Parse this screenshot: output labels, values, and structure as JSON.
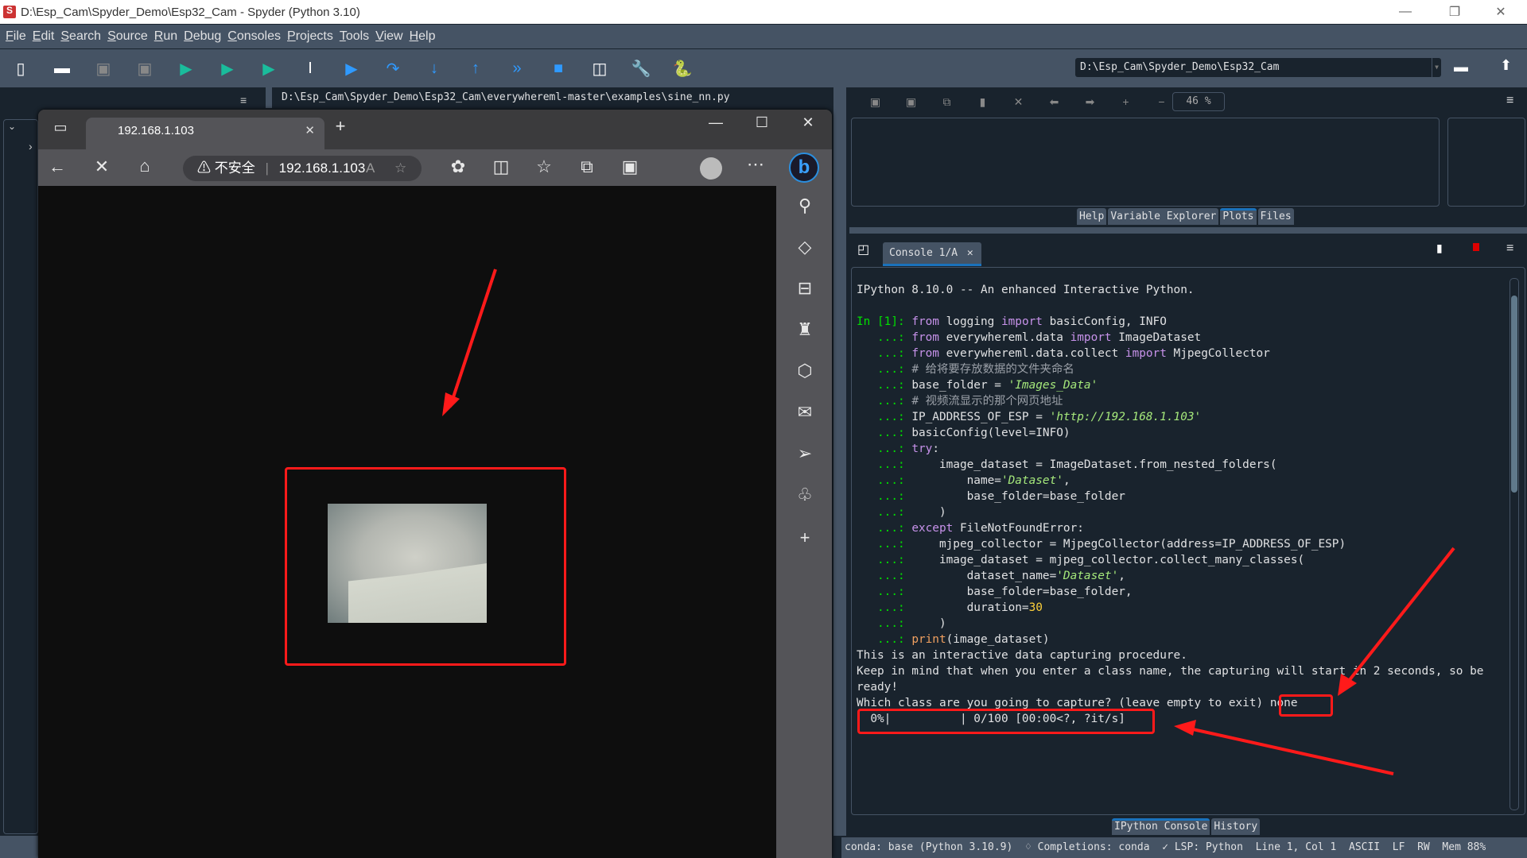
{
  "window": {
    "title": "D:\\Esp_Cam\\Spyder_Demo\\Esp32_Cam - Spyder (Python 3.10)",
    "min": "—",
    "restore": "❐",
    "close": "✕"
  },
  "menu": [
    "File",
    "Edit",
    "Search",
    "Source",
    "Run",
    "Debug",
    "Consoles",
    "Projects",
    "Tools",
    "View",
    "Help"
  ],
  "toolbar": {
    "icons": [
      {
        "name": "new-file-icon",
        "glyph": "▯",
        "color": "#ffffff"
      },
      {
        "name": "open-file-icon",
        "glyph": "▬",
        "color": "#ffffff"
      },
      {
        "name": "save-icon",
        "glyph": "▣",
        "color": "#888888"
      },
      {
        "name": "save-all-icon",
        "glyph": "▣",
        "color": "#888888"
      },
      {
        "name": "run-icon",
        "glyph": "▶",
        "color": "#1abc9c"
      },
      {
        "name": "run-cell-icon",
        "glyph": "▶",
        "color": "#1abc9c"
      },
      {
        "name": "run-cell-advance-icon",
        "glyph": "▶",
        "color": "#1abc9c"
      },
      {
        "name": "run-selection-icon",
        "glyph": "I",
        "color": "#ffffff"
      },
      {
        "name": "debug-icon",
        "glyph": "▶",
        "color": "#2f9aff"
      },
      {
        "name": "step-over-icon",
        "glyph": "↷",
        "color": "#2f9aff"
      },
      {
        "name": "step-into-icon",
        "glyph": "↓",
        "color": "#2f9aff"
      },
      {
        "name": "step-return-icon",
        "glyph": "↑",
        "color": "#2f9aff"
      },
      {
        "name": "continue-icon",
        "glyph": "»",
        "color": "#2f9aff"
      },
      {
        "name": "stop-debug-icon",
        "glyph": "■",
        "color": "#2f9aff"
      },
      {
        "name": "maximize-pane-icon",
        "glyph": "◫",
        "color": "#ffffff"
      },
      {
        "name": "preferences-wrench-icon",
        "glyph": "🔧",
        "color": "#ffffff"
      },
      {
        "name": "python-path-icon",
        "glyph": "🐍",
        "color": "#f5c542"
      }
    ],
    "cwd": "D:\\Esp_Cam\\Spyder_Demo\\Esp32_Cam"
  },
  "editor": {
    "path": "D:\\Esp_Cam\\Spyder_Demo\\Esp32_Cam\\everywhereml-master\\examples\\sine_nn.py"
  },
  "browser": {
    "tab_title": "192.168.1.103",
    "security_label": "不安全",
    "url": "192.168.1.103",
    "sidebar_icons": [
      "search-icon",
      "tag-icon",
      "toolbox-icon",
      "games-chess-icon",
      "office-icon",
      "outlook-icon",
      "send-icon",
      "tree-icon",
      "add-icon"
    ]
  },
  "plots": {
    "zoom": "46 %",
    "tabs": [
      "Help",
      "Variable Explorer",
      "Plots",
      "Files"
    ],
    "active_tab": "Plots"
  },
  "console": {
    "tab_label": "Console 1/A",
    "header": "IPython 8.10.0 -- An enhanced Interactive Python.",
    "prompt_in": "In [1]:",
    "cont": "   ...:",
    "code": [
      [
        [
          "kw",
          "from"
        ],
        [
          "t",
          " logging "
        ],
        [
          "kw",
          "import"
        ],
        [
          "t",
          " basicConfig, INFO"
        ]
      ],
      [
        [
          "kw",
          "from"
        ],
        [
          "t",
          " everywhereml.data "
        ],
        [
          "kw",
          "import"
        ],
        [
          "t",
          " ImageDataset"
        ]
      ],
      [
        [
          "kw",
          "from"
        ],
        [
          "t",
          " everywhereml.data.collect "
        ],
        [
          "kw",
          "import"
        ],
        [
          "t",
          " MjpegCollector"
        ]
      ],
      [
        [
          "cm",
          "# 给将要存放数据的文件夹命名"
        ]
      ],
      [
        [
          "t",
          "base_folder = "
        ],
        [
          "st",
          "'Images_Data'"
        ]
      ],
      [
        [
          "cm",
          "# 视频流显示的那个网页地址"
        ]
      ],
      [
        [
          "t",
          "IP_ADDRESS_OF_ESP = "
        ],
        [
          "st",
          "'http://192.168.1.103'"
        ]
      ],
      [
        [
          "t",
          "basicConfig(level=INFO)"
        ]
      ],
      [
        [
          "kw",
          "try"
        ],
        [
          "t",
          ":"
        ]
      ],
      [
        [
          "t",
          "    image_dataset = ImageDataset.from_nested_folders("
        ]
      ],
      [
        [
          "t",
          "        name="
        ],
        [
          "st",
          "'Dataset'"
        ],
        [
          "t",
          ","
        ]
      ],
      [
        [
          "t",
          "        base_folder=base_folder"
        ]
      ],
      [
        [
          "t",
          "    )"
        ]
      ],
      [
        [
          "kw",
          "except"
        ],
        [
          "t",
          " FileNotFoundError:"
        ]
      ],
      [
        [
          "t",
          "    mjpeg_collector = MjpegCollector(address=IP_ADDRESS_OF_ESP)"
        ]
      ],
      [
        [
          "t",
          "    image_dataset = mjpeg_collector.collect_many_classes("
        ]
      ],
      [
        [
          "t",
          "        dataset_name="
        ],
        [
          "st",
          "'Dataset'"
        ],
        [
          "t",
          ","
        ]
      ],
      [
        [
          "t",
          "        base_folder=base_folder,"
        ]
      ],
      [
        [
          "t",
          "        duration="
        ],
        [
          "nm",
          "30"
        ]
      ],
      [
        [
          "t",
          "    )"
        ]
      ],
      [
        [
          "fn",
          "print"
        ],
        [
          "t",
          "(image_dataset)"
        ]
      ]
    ],
    "output": [
      "This is an interactive data capturing procedure.",
      "Keep in mind that when you enter a class name, the capturing will start in 2 seconds, so be",
      "ready!",
      "Which class are you going to capture? (leave empty to exit) none"
    ],
    "progress": {
      "text": "  0%|          | 0/100 [00:00<?, ?it/s]",
      "percent": 0,
      "done": 0,
      "total": 100
    },
    "bottom_tabs": [
      "IPython Console",
      "History"
    ],
    "active_bottom_tab": "IPython Console"
  },
  "status": {
    "conda": "conda: base (Python 3.10.9)",
    "completions": "Completions: conda",
    "lsp": "LSP: Python",
    "position": "Line 1, Col 1",
    "encoding": "ASCII",
    "eol": "LF",
    "rw": "RW",
    "mem": "Mem 88%"
  }
}
